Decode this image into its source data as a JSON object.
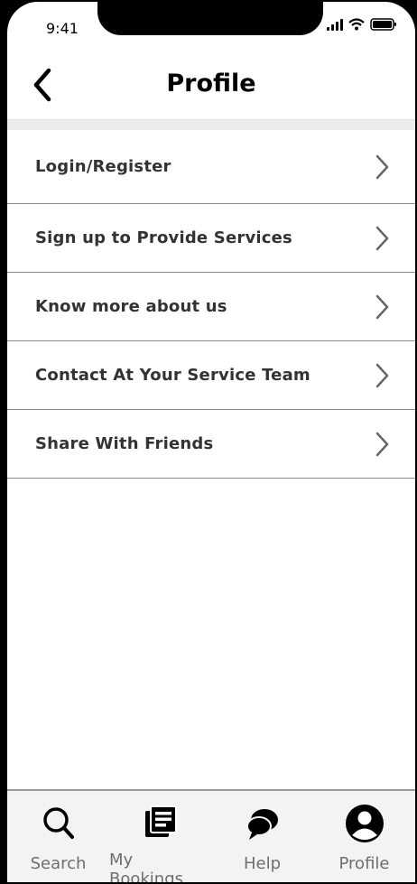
{
  "status_bar": {
    "time": "9:41"
  },
  "header": {
    "title": "Profile",
    "back_icon": "chevron-left-icon"
  },
  "menu": {
    "items": [
      {
        "label": "Login/Register",
        "icon": "chevron-right-icon"
      },
      {
        "label": "Sign up to Provide Services",
        "icon": "chevron-right-icon"
      },
      {
        "label": "Know more about us",
        "icon": "chevron-right-icon"
      },
      {
        "label": "Contact At Your Service Team",
        "icon": "chevron-right-icon"
      },
      {
        "label": "Share With Friends",
        "icon": "chevron-right-icon"
      }
    ]
  },
  "tabbar": {
    "tabs": [
      {
        "label": "Search",
        "icon": "search-icon"
      },
      {
        "label": "My Bookings",
        "icon": "bookings-icon"
      },
      {
        "label": "Help",
        "icon": "chat-bubble-icon"
      },
      {
        "label": "Profile",
        "icon": "user-icon"
      }
    ]
  }
}
